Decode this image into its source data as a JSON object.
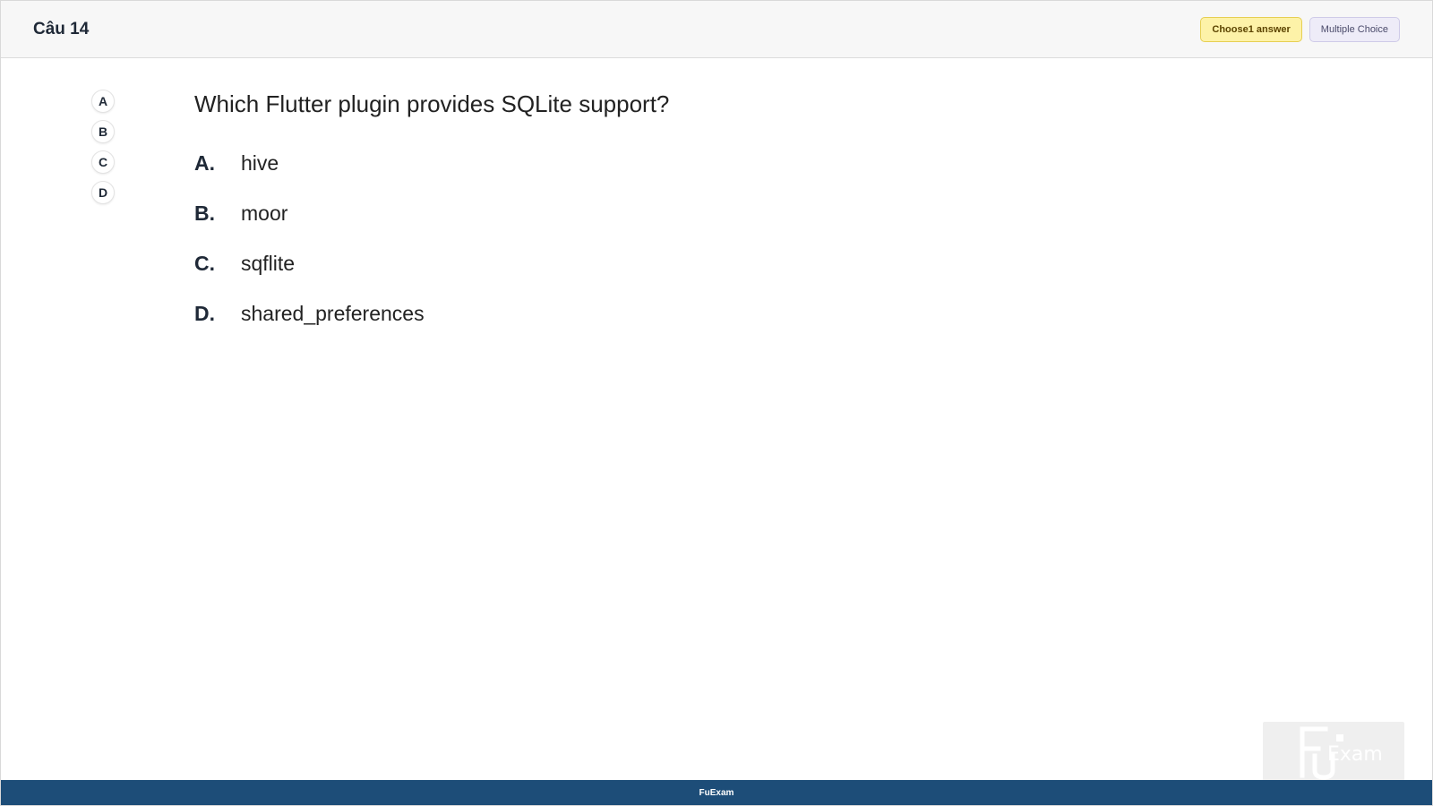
{
  "header": {
    "question_number": "Câu 14",
    "badge_choose": "Choose1 answer",
    "badge_type": "Multiple Choice"
  },
  "answer_rail": [
    "A",
    "B",
    "C",
    "D"
  ],
  "question": {
    "text": "Which Flutter plugin provides SQLite support?",
    "options": [
      {
        "letter": "A.",
        "text": "hive"
      },
      {
        "letter": "B.",
        "text": "moor"
      },
      {
        "letter": "C.",
        "text": "sqflite"
      },
      {
        "letter": "D.",
        "text": "shared_preferences"
      }
    ]
  },
  "watermark": {
    "text": "Exam"
  },
  "footer": {
    "text": "FuExam"
  },
  "colors": {
    "footer_bg": "#1d4d78",
    "badge_choose_bg": "#fdf2a8",
    "badge_type_bg": "#eeecf8"
  }
}
